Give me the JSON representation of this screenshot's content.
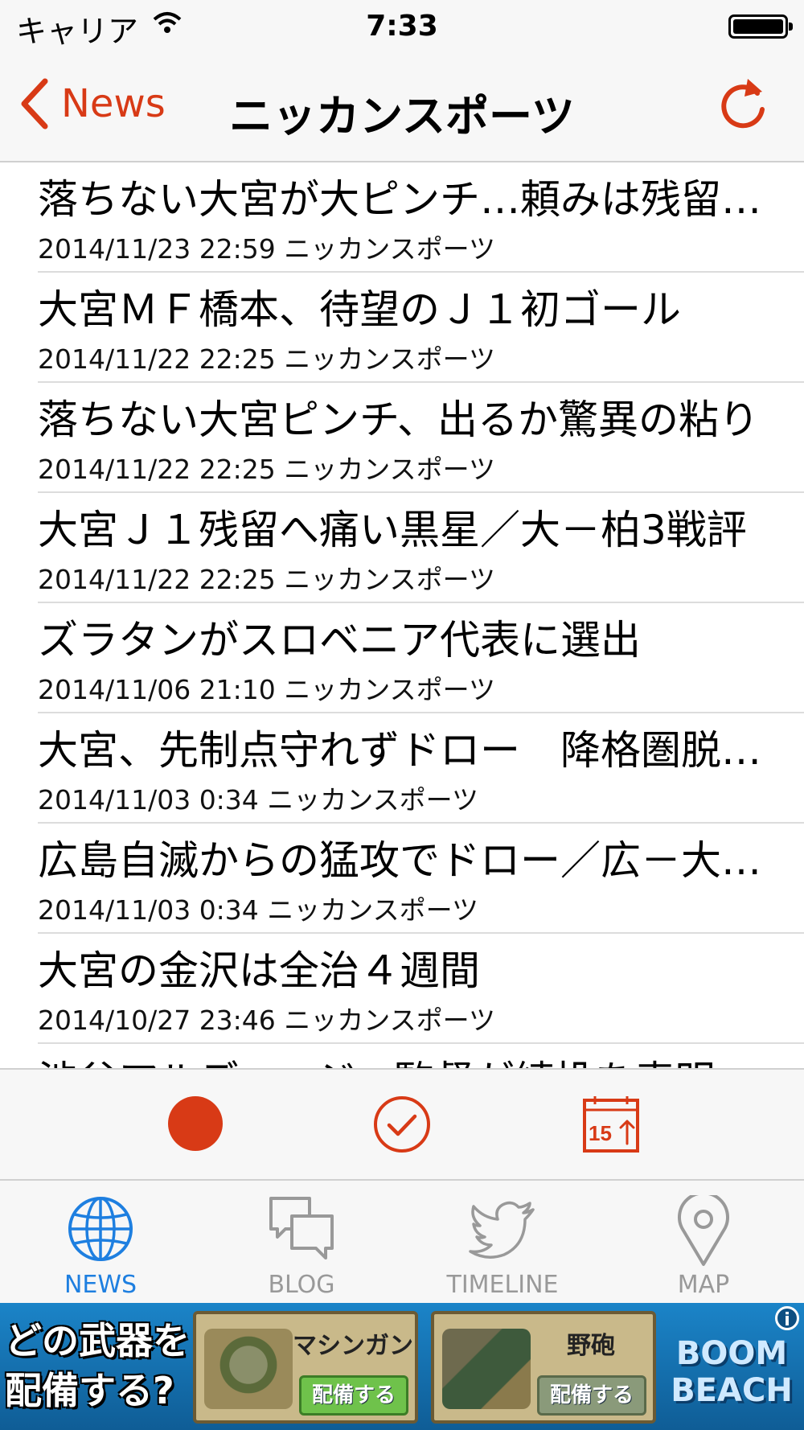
{
  "status_bar": {
    "carrier": "キャリア",
    "time": "7:33"
  },
  "nav": {
    "back_label": "News",
    "title": "ニッカンスポーツ"
  },
  "articles": [
    {
      "title": "落ちない大宮が大ピンチ…頼みは残留の鍵となる一戦",
      "date": "2014/11/23 22:59",
      "source": "ニッカンスポーツ"
    },
    {
      "title": "大宮ＭＦ橋本、待望のＪ１初ゴール",
      "date": "2014/11/22 22:25",
      "source": "ニッカンスポーツ"
    },
    {
      "title": "落ちない大宮ピンチ、出るか驚異の粘り",
      "date": "2014/11/22 22:25",
      "source": "ニッカンスポーツ"
    },
    {
      "title": "大宮Ｊ１残留へ痛い黒星／大－柏3戦評",
      "date": "2014/11/22 22:25",
      "source": "ニッカンスポーツ"
    },
    {
      "title": "ズラタンがスロベニア代表に選出",
      "date": "2014/11/06 21:10",
      "source": "ニッカンスポーツ"
    },
    {
      "title": "大宮、先制点守れずドロー　降格圏脱出ならず",
      "date": "2014/11/03 0:34",
      "source": "ニッカンスポーツ"
    },
    {
      "title": "広島自滅からの猛攻でドロー／広－大戦評",
      "date": "2014/11/03 0:34",
      "source": "ニッカンスポーツ"
    },
    {
      "title": "大宮の金沢は全治４週間",
      "date": "2014/10/27 23:46",
      "source": "ニッカンスポーツ"
    },
    {
      "title": "渋谷アルディージャ監督が続投を表明した",
      "date": "",
      "source": ""
    }
  ],
  "toolbar": {
    "calendar_day": "15"
  },
  "tabs": [
    {
      "label": "NEWS",
      "icon": "globe-icon",
      "active": true
    },
    {
      "label": "BLOG",
      "icon": "chat-bubbles-icon",
      "active": false
    },
    {
      "label": "TIMELINE",
      "icon": "bird-icon",
      "active": false
    },
    {
      "label": "MAP",
      "icon": "map-pin-icon",
      "active": false
    }
  ],
  "ad": {
    "question": "どの武器を配備する?",
    "question_line1": "どの武器を",
    "question_line2": "配備する?",
    "card1_name": "マシンガン",
    "card1_button": "配備する",
    "card2_name": "野砲",
    "card2_button": "配備する",
    "logo_line1": "BOOM",
    "logo_line2": "BEACH",
    "info": "i"
  },
  "colors": {
    "accent": "#d83a16",
    "tab_active": "#1e7fe0",
    "tab_inactive": "#999999"
  }
}
